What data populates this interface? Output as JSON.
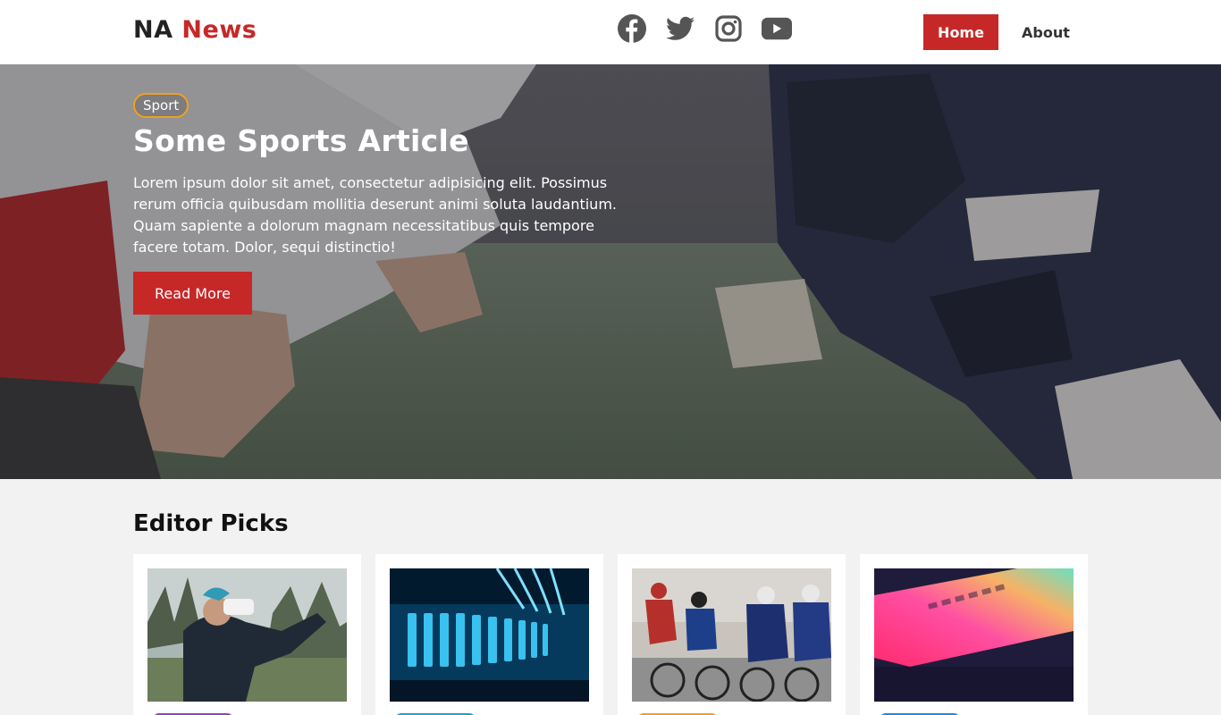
{
  "header": {
    "logo_prefix": "NA",
    "logo_main": "News",
    "social": [
      "facebook-icon",
      "twitter-icon",
      "instagram-icon",
      "youtube-icon"
    ],
    "nav": {
      "home": "Home",
      "about": "About"
    }
  },
  "hero": {
    "tag": "Sport",
    "title": "Some Sports Article",
    "text": "Lorem ipsum dolor sit amet, consectetur adipisicing elit. Possimus rerum officia quibusdam mollitia deserunt animi soluta laudantium. Quam sapiente a dolorum magnam necessitatibus quis tempore facere totam. Dolor, sequi distinctio!",
    "button": "Read More"
  },
  "editor_picks": {
    "title": "Editor Picks",
    "cards": [
      {
        "image": "vr-headset-photo",
        "badge_color": "#8e44ad"
      },
      {
        "image": "server-rack-photo",
        "badge_color": "#1aa3c4"
      },
      {
        "image": "cyclists-photo",
        "badge_color": "#f0a020"
      },
      {
        "image": "laptop-keyboard-photo",
        "badge_color": "#1e88e5"
      }
    ]
  },
  "colors": {
    "accent": "#c62828",
    "sport_tag": "#f0a020"
  }
}
